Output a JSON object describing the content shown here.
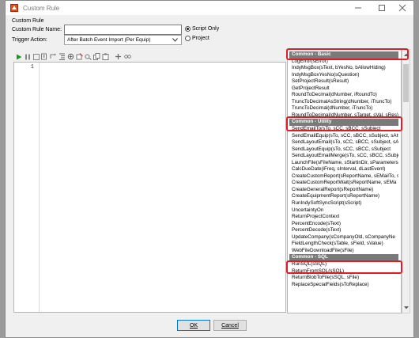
{
  "window": {
    "title": "Custom Rule"
  },
  "section_heading": "Custom Rule",
  "fields": {
    "rule_name_label": "Custom Rule Name:",
    "rule_name_value": "",
    "trigger_action_label": "Trigger Action:",
    "trigger_action_value": "After Batch Event Import (Per Equip)"
  },
  "scope": {
    "script_only_label": "Script Only",
    "script_only_selected": true,
    "project_label": "Project",
    "project_selected": false
  },
  "editor": {
    "line_numbers": [
      "1"
    ]
  },
  "functions": [
    {
      "text": "Common - Basic",
      "type": "category"
    },
    {
      "text": "LogError(sError)",
      "type": "item"
    },
    {
      "text": "IndyMsgBox(sText, bYesNo, bAllowHiding)",
      "type": "item"
    },
    {
      "text": "IndyMsgBoxYesNo(sQuestion)",
      "type": "item"
    },
    {
      "text": "SetProjectResult(sResult)",
      "type": "item"
    },
    {
      "text": "GetProjectResult",
      "type": "item"
    },
    {
      "text": "RoundToDecimal(dNumber, iRoundTo)",
      "type": "item"
    },
    {
      "text": "TruncToDecimalAsString(dNumber, iTruncTo)",
      "type": "item"
    },
    {
      "text": "TruncToDecimal(dNumber, iTruncTo)",
      "type": "item"
    },
    {
      "text": "RoundToDecimal(dNumber, sTarget, sVal, sRes)",
      "type": "item"
    },
    {
      "text": "Common - Utility",
      "type": "category"
    },
    {
      "text": "SendEmailTo(sTo, sCC, sBCC, sSubject",
      "type": "item"
    },
    {
      "text": "SendEmailEquip(sTo, sCC, sBCC, sSubject, sAtt",
      "type": "item"
    },
    {
      "text": "SendLayoutEmail(sTo, sCC, sBCC, sSubject, sAtt",
      "type": "item"
    },
    {
      "text": "SendLayoutEquip(sTo, sCC, sBCC, sSubject",
      "type": "item"
    },
    {
      "text": "SendLayoutEmailMerge(sTo, sCC, sBCC, sSubje",
      "type": "item"
    },
    {
      "text": "LaunchFile(sFileName, sStartinDir, sParameters",
      "type": "item"
    },
    {
      "text": "CalcDueDate(iFreq, sInterval, dLastEvent)",
      "type": "item"
    },
    {
      "text": "CreateCustomReport(sReportName, sEMailTo, s",
      "type": "item"
    },
    {
      "text": "CreateCustomReportWait(sReportName, sEMa",
      "type": "item"
    },
    {
      "text": "CreateGeneralReport(sReportName)",
      "type": "item"
    },
    {
      "text": "CreateEquipmentReport(sReportName)",
      "type": "item"
    },
    {
      "text": "RunIndySoftSyncScript(sScript)",
      "type": "item"
    },
    {
      "text": "UncertaintyOn",
      "type": "item"
    },
    {
      "text": "ReturnProjectContext",
      "type": "item"
    },
    {
      "text": "PercentEncode(sText)",
      "type": "item"
    },
    {
      "text": "PercentDecode(sText)",
      "type": "item"
    },
    {
      "text": "UpdateCompany(sCompanyOld, sCompanyNe",
      "type": "item"
    },
    {
      "text": "FieldLengthCheck(sTable, sField, sValue)",
      "type": "item"
    },
    {
      "text": "WebFileDownloadFile(sFile)",
      "type": "item"
    },
    {
      "text": "Common - SQL",
      "type": "category"
    },
    {
      "text": "RunSQL(sSQL)",
      "type": "item"
    },
    {
      "text": "ReturnFromSQL(sSQL)",
      "type": "item"
    },
    {
      "text": "ReturnBlobToFile(sSQL, sFile)",
      "type": "item"
    },
    {
      "text": "ReplaceSpecialFields(sToReplace)",
      "type": "item"
    }
  ],
  "buttons": {
    "ok": "OK",
    "cancel": "Cancel"
  },
  "colors": {
    "highlight": "#e31c23",
    "category_bg": "#7a7a7a",
    "run_green": "#1a9c1a"
  }
}
